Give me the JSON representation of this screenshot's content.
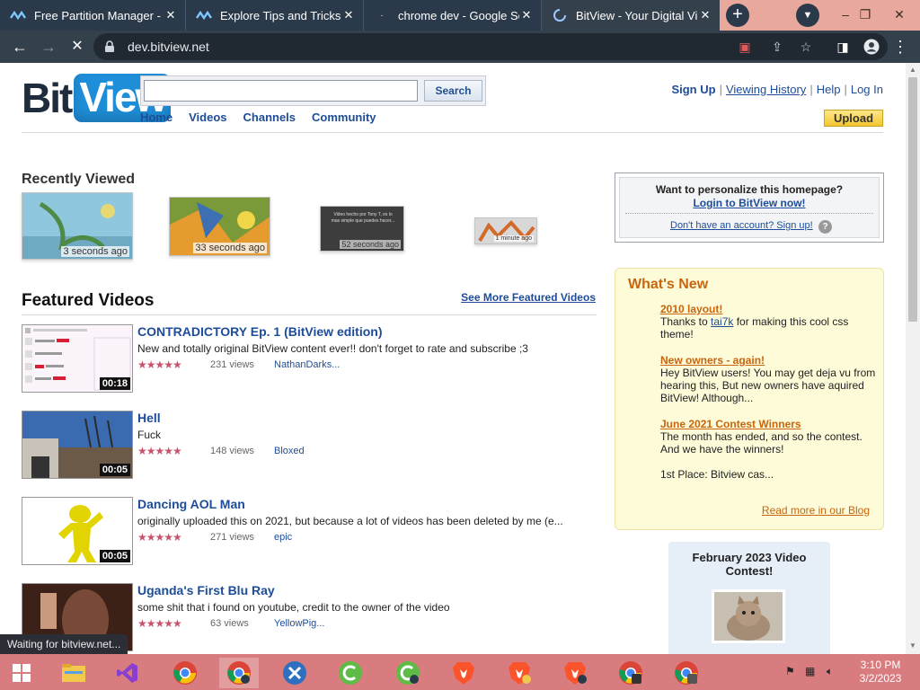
{
  "browser": {
    "tabs": [
      {
        "title": "Free Partition Manager -",
        "icon": "wave-icon",
        "state": "inactive"
      },
      {
        "title": "Explore Tips and Tricks in",
        "icon": "wave-icon",
        "state": "inactive"
      },
      {
        "title": "chrome dev - Google Sea",
        "icon": "google-icon",
        "state": "inactive"
      },
      {
        "title": "BitView - Your Digital Vid",
        "icon": "loading-spinner-icon",
        "state": "active"
      }
    ],
    "url": "dev.bitview.net",
    "accent": "#35404d",
    "tabbar_color": "#e9a89c"
  },
  "site": {
    "logo": {
      "bit": "Bit",
      "view": "View"
    },
    "search": {
      "value": "",
      "button": "Search"
    },
    "nav": [
      "Home",
      "Videos",
      "Channels",
      "Community"
    ],
    "user_links": {
      "signup": "Sign Up",
      "history": "Viewing History",
      "help": "Help",
      "login": "Log In"
    },
    "upload": "Upload"
  },
  "recently_viewed": {
    "title": "Recently Viewed",
    "items": [
      {
        "time": "3 seconds ago"
      },
      {
        "time": "33 seconds ago"
      },
      {
        "time": "52 seconds ago",
        "caption": "Video hecho por Tony T, es lo mas simple que puedes hacer..."
      },
      {
        "time": "1 minute ago"
      }
    ]
  },
  "featured": {
    "title": "Featured Videos",
    "more": "See More Featured Videos",
    "videos": [
      {
        "title": "CONTRADICTORY Ep. 1 (BitView edition)",
        "desc": "New and totally original BitView content ever!! don't forget to rate and subscribe ;3",
        "stars": "★★★★★",
        "views": "231 views",
        "user": "NathanDarks...",
        "duration": "00:18"
      },
      {
        "title": "Hell",
        "desc": "Fuck",
        "stars": "★★★★★",
        "views": "148 views",
        "user": "Bloxed",
        "duration": "00:05"
      },
      {
        "title": "Dancing AOL Man",
        "desc": "originally uploaded this on 2021, but because a lot of videos has been deleted by me (e...",
        "stars": "★★★★★",
        "views": "271 views",
        "user": "epic",
        "duration": "00:05"
      },
      {
        "title": "Uganda's First Blu Ray",
        "desc": "some shit that i found on youtube, credit to the owner of the video",
        "stars": "★★★★★",
        "views": "63 views",
        "user": "YellowPig...",
        "duration": ""
      }
    ]
  },
  "personalize": {
    "question": "Want to personalize this homepage?",
    "login": "Login to BitView now!",
    "signup": "Don't have an account? Sign up!",
    "help": "?"
  },
  "whats_new": {
    "title": "What's New",
    "items": [
      {
        "head": "2010 layout!",
        "body_pre": "Thanks to ",
        "link": "tai7k",
        "body_post": " for making this cool css theme!"
      },
      {
        "head": "New owners - again!",
        "body": "Hey BitView users! You may get deja vu from hearing this, But new owners have aquired BitView! Although..."
      },
      {
        "head": "June 2021 Contest Winners",
        "body": "The month has ended, and so the contest. And we have the winners!",
        "body2": "1st Place: Bitview cas..."
      }
    ],
    "more": "Read more in our Blog"
  },
  "contest": {
    "title": "February 2023 Video Contest!"
  },
  "status": "Waiting for bitview.net...",
  "taskbar": {
    "apps": [
      "windows-start-icon",
      "file-explorer-icon",
      "visual-studio-icon",
      "chrome-icon",
      "chrome-icon",
      "tools-icon",
      "cclean-icon",
      "cclean-icon",
      "brave-icon",
      "brave-icon",
      "brave-icon",
      "chrome-icon",
      "chrome-icon"
    ],
    "time": "3:10 PM",
    "date": "3/2/2023"
  }
}
